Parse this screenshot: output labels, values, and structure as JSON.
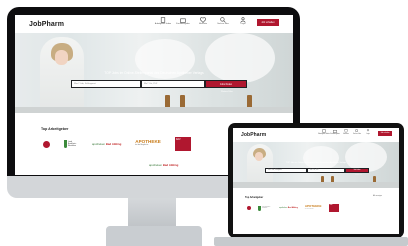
{
  "site": {
    "logo": "JobPharm",
    "nav": [
      {
        "label": "Arbeitgeber finden",
        "icon": "building-icon"
      },
      {
        "label": "Für Arbeitgeber",
        "icon": "briefcase-icon"
      },
      {
        "label": "Merkliste",
        "icon": "heart-icon"
      },
      {
        "label": "Suchen Jobs",
        "icon": "search-icon"
      },
      {
        "label": "Login",
        "icon": "user-icon"
      }
    ],
    "job_button": "Job schalten"
  },
  "hero": {
    "tagline": "TOP Jobs im Online-Stellenportal des Deutschen Apotheker Verlags",
    "what_placeholder": "Was? Job, Schlagwort",
    "where_placeholder": "Wo? Ort, PLZ",
    "search_button": "Jobs finden",
    "filters_label": "Weitere Filter"
  },
  "employers": {
    "title": "Top Arbeitgeber",
    "link": "Alle anzeigen",
    "nrw_text": "Land Nordrhein-Westfalen",
    "apo_green": "apotheken",
    "apo_red": "Bad Aibling",
    "apotheke_name": "APOTHEKE",
    "apotheke_sub": "bei der Bergkirche",
    "red_badge": "DAV"
  },
  "colors": {
    "brand": "#b0172f",
    "dark": "#1c1c1c"
  }
}
